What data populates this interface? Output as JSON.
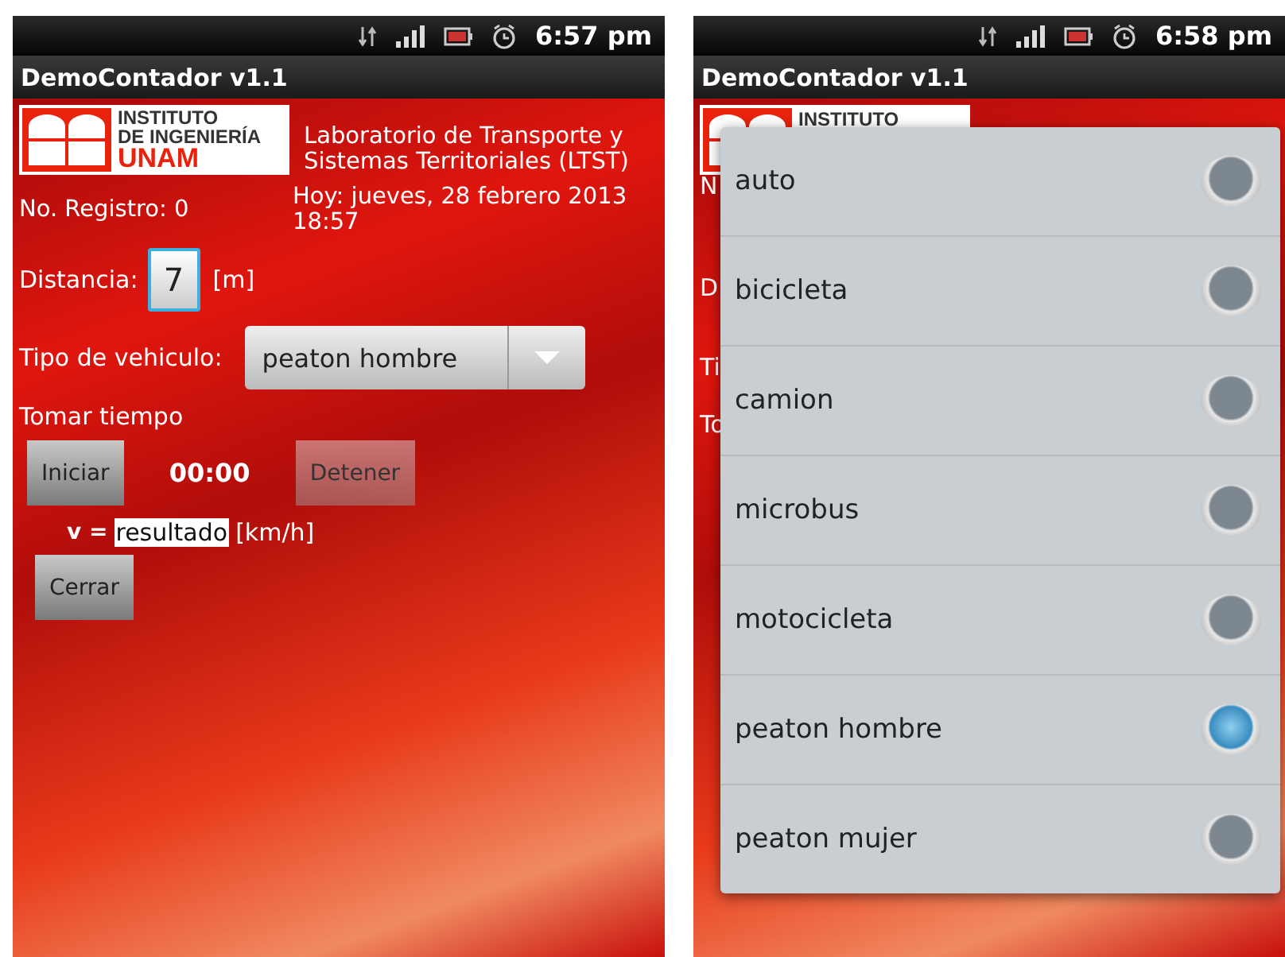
{
  "form_screen": {
    "status_bar": {
      "time": "6:57 pm"
    },
    "app_bar": {
      "title": "DemoContador v1.1"
    },
    "logo": {
      "lines": [
        "INSTITUTO",
        "DE INGENIERÍA",
        "UNAM"
      ]
    },
    "lab_name": "Laboratorio de Transporte y Sistemas Territoriales (LTST)",
    "registro": "No. Registro: 0",
    "fecha": "Hoy: jueves, 28 febrero 2013 18:57",
    "distancia": {
      "label": "Distancia:",
      "value": "7",
      "unit": "[m]"
    },
    "tipo": {
      "label": "Tipo de vehiculo:",
      "value": "peaton hombre"
    },
    "tomar_tiempo": "Tomar tiempo",
    "timer": {
      "start": {
        "label": "Iniciar",
        "disabled": false
      },
      "time": "00:00",
      "stop": {
        "label": "Detener",
        "disabled": true
      }
    },
    "velocidad": {
      "symbol": "v =",
      "value": "resultado",
      "unit": "[km/h]"
    },
    "cerrar": {
      "label": "Cerrar",
      "disabled": false
    }
  },
  "picker_screen": {
    "status_bar": {
      "time": "6:58 pm"
    },
    "app_bar": {
      "title": "DemoContador v1.1"
    },
    "logo": {
      "lines": [
        "INSTITUTO"
      ]
    },
    "covered_labels": [
      "N",
      "D",
      "Ti",
      "To"
    ],
    "options": [
      {
        "label": "auto",
        "selected": false
      },
      {
        "label": "bicicleta",
        "selected": false
      },
      {
        "label": "camion",
        "selected": false
      },
      {
        "label": "microbus",
        "selected": false
      },
      {
        "label": "motocicleta",
        "selected": false
      },
      {
        "label": "peaton hombre",
        "selected": true
      },
      {
        "label": "peaton mujer",
        "selected": false
      }
    ]
  }
}
